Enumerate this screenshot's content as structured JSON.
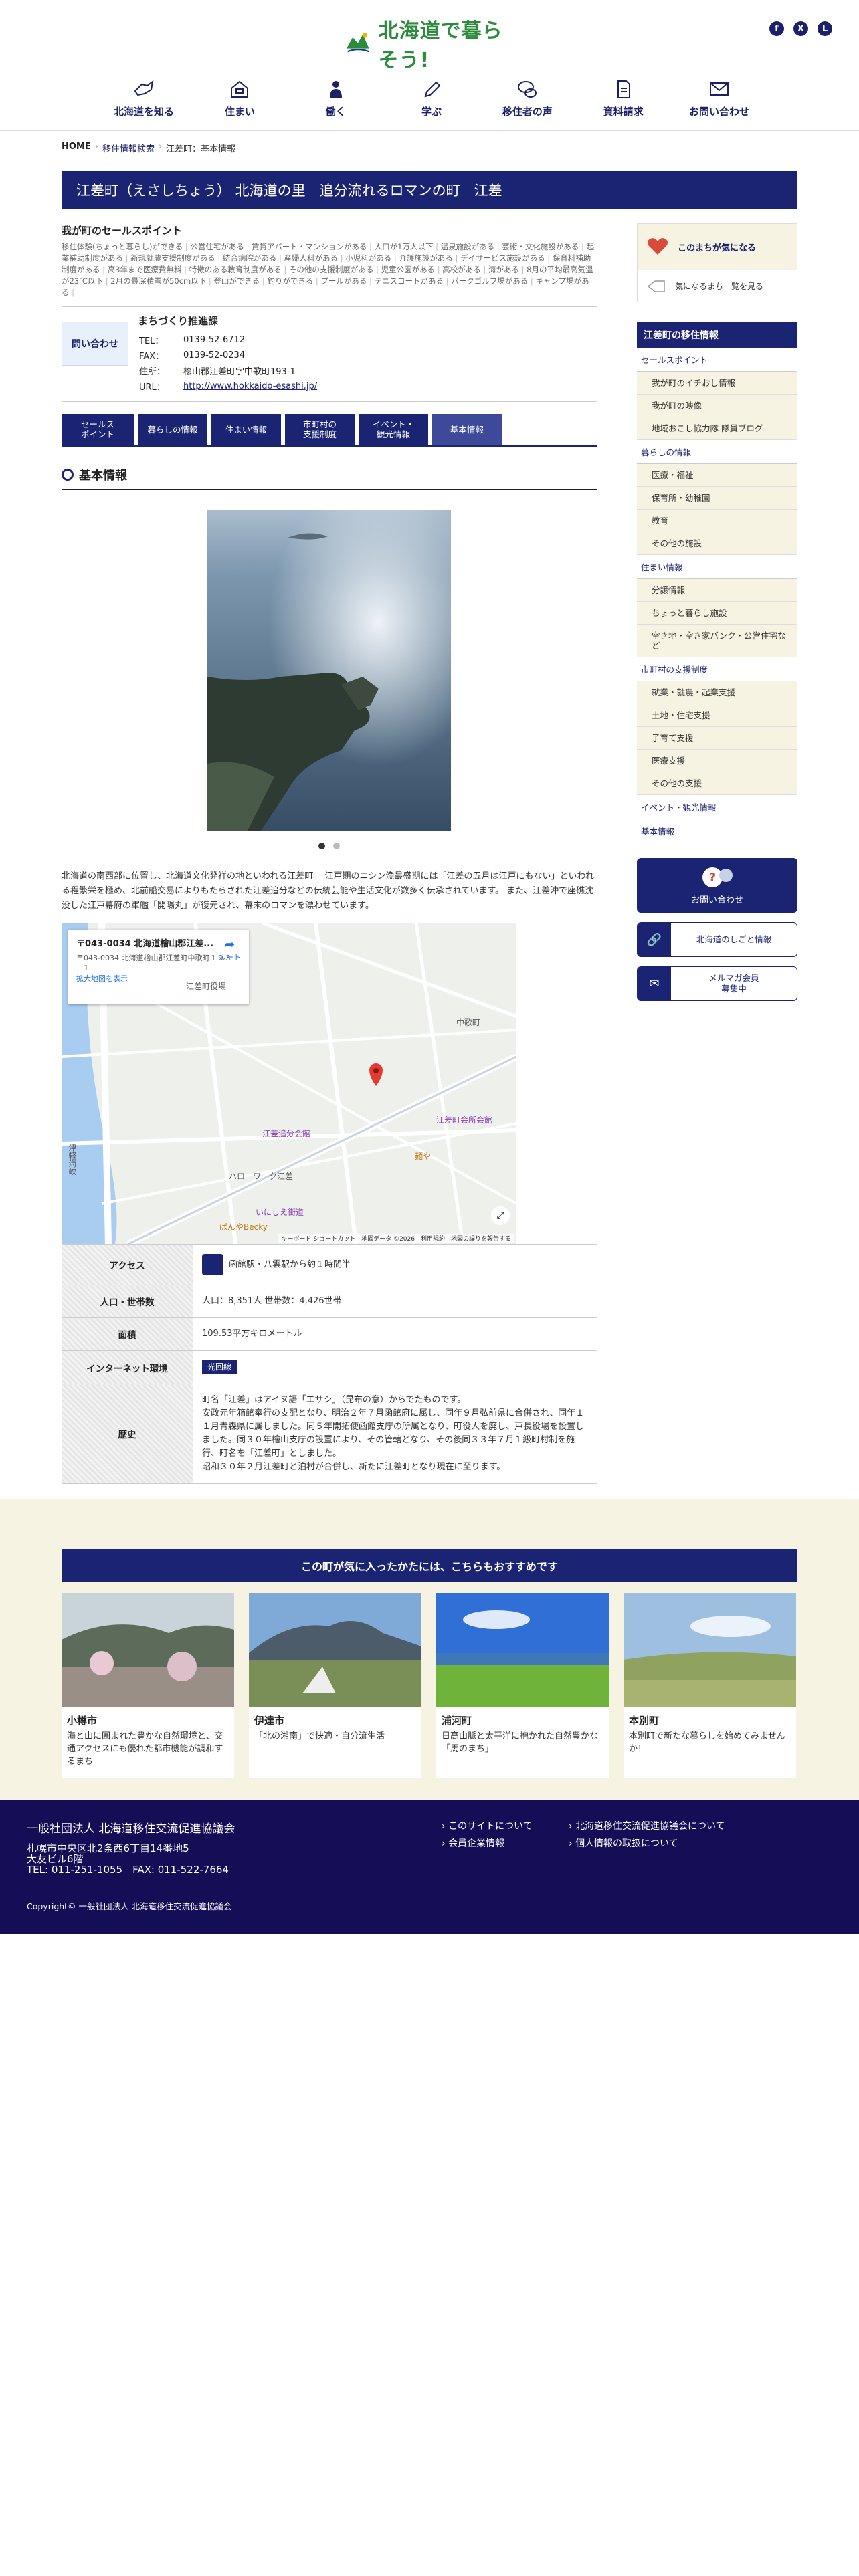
{
  "header": {
    "logo_text": "北海道で暮らそう!",
    "nav": [
      {
        "label": "北海道を知る",
        "icon": "hokkaido-icon"
      },
      {
        "label": "住まい",
        "icon": "house-icon"
      },
      {
        "label": "働く",
        "icon": "worker-icon"
      },
      {
        "label": "学ぶ",
        "icon": "pencil-icon"
      },
      {
        "label": "移住者の声",
        "icon": "speech-bubble-icon"
      },
      {
        "label": "資料請求",
        "icon": "document-icon"
      },
      {
        "label": "お問い合わせ",
        "icon": "mail-icon"
      }
    ],
    "social": [
      "facebook-icon",
      "x-icon",
      "line-icon"
    ]
  },
  "breadcrumb": [
    "HOME",
    "移住情報検索",
    "江差町：基本情報"
  ],
  "title": "江差町（えさしちょう） 北海道の里　追分流れるロマンの町　江差",
  "selling": {
    "heading": "我が町のセールスポイント",
    "tags": [
      "移住体験(ちょっと暮らし)ができる",
      "公営住宅がある",
      "賃貸アパート・マンションがある",
      "人口が1万人以下",
      "温泉施設がある",
      "芸術・文化施設がある",
      "起業補助制度がある",
      "新規就農支援制度がある",
      "結合病院がある",
      "産婦人科がある",
      "小児科がある",
      "介護施設がある",
      "デイサービス施設がある",
      "保育料補助制度がある",
      "高3年まで医療費無料",
      "特徴のある教育制度がある",
      "その他の支援制度がある",
      "児童公園がある",
      "高校がある",
      "海がある",
      "8月の平均最高気温が23℃以下",
      "2月の最深積雪が50cm以下",
      "登山ができる",
      "釣りができる",
      "プールがある",
      "テニスコートがある",
      "パークゴルフ場がある",
      "キャンプ場がある"
    ]
  },
  "contact": {
    "button_label": "問い合わせ",
    "org": "まちづくり推進課",
    "rows": [
      {
        "k": "TEL：",
        "v": "0139-52-6712"
      },
      {
        "k": "FAX：",
        "v": "0139-52-0234"
      },
      {
        "k": "住所：",
        "v": "桧山郡江差町字中歌町193-1"
      }
    ],
    "url_label": "URL：",
    "url": "http://www.hokkaido-esashi.jp/"
  },
  "tabs": [
    "セールス\nポイント",
    "暮らしの情報",
    "住まい情報",
    "市町村の\n支援制度",
    "イベント・\n観光情報",
    "基本情報"
  ],
  "section_title": "基本情報",
  "intro": "北海道の南西部に位置し、北海道文化発祥の地といわれる江差町。 江戸期のニシン漁最盛期には「江差の五月は江戸にもない」といわれる程繁栄を極め、北前船交易によりもたらされた江差追分などの伝統芸能や生活文化が数多く伝承されています。 また、江差沖で座礁沈没した江戸幕府の軍艦「開陽丸」が復元され、幕末のロマンを漂わせています。",
  "map": {
    "title": "〒043-0034 北海道檜山郡江差...",
    "address": "〒043-0034 北海道檜山郡江差町中歌町１９３−１",
    "route": "ルート",
    "enlarge": "拡大地図を表示",
    "labels": [
      "津軽海峡",
      "江差町役場",
      "江差追分会館",
      "江差町会所会館",
      "麺や",
      "ハローワーク江差",
      "いにしえ街道",
      "中歌町",
      "ぱんやBecky"
    ],
    "attribution": "キーボード ショートカット　地図データ ©2026　利用規約　地図の誤りを報告する"
  },
  "table": [
    {
      "k": "アクセス",
      "v": "函館駅・八雲駅から約１時間半"
    },
    {
      "k": "人口・世帯数",
      "v": "人口：8,351人 世帯数：4,426世帯"
    },
    {
      "k": "面積",
      "v": "109.53平方キロメートル"
    },
    {
      "k": "インターネット環境",
      "v": "光回線"
    },
    {
      "k": "歴史",
      "v": "町名「江差」はアイヌ語「エサシ」（昆布の意）からでたものです。\n安政元年箱館奉行の支配となり、明治２年７月函館府に属し、同年９月弘前県に合併され、同年１１月青森県に属しました。同５年開拓使函館支庁の所属となり、町役人を廃し、戸長役場を設置しました。同３０年檜山支庁の設置により、その管轄となり、その後同３３年７月１級町村制を施行、町名を「江差町」としました。\n昭和３０年２月江差町と泊村が合併し、新たに江差町となり現在に至ります。"
    }
  ],
  "sidebar": {
    "fav_label": "このまちが気になる",
    "fav_list_label": "気になるまち一覧を見る",
    "heading": "江差町の移住情報",
    "groups": [
      {
        "cat": "セールスポイント",
        "items": [
          "我が町のイチおし情報",
          "我が町の映像",
          "地域おこし協力隊 隊員ブログ"
        ]
      },
      {
        "cat": "暮らしの情報",
        "items": [
          "医療・福祉",
          "保育所・幼稚園",
          "教育",
          "その他の施設"
        ]
      },
      {
        "cat": "住まい情報",
        "items": [
          "分譲情報",
          "ちょっと暮らし施設",
          "空き地・空き家バンク・公営住宅など"
        ]
      },
      {
        "cat": "市町村の支援制度",
        "items": [
          "就業・就農・起業支援",
          "土地・住宅支援",
          "子育て支援",
          "医療支援",
          "その他の支援"
        ]
      }
    ],
    "extra_cats": [
      "イベント・観光情報",
      "基本情報"
    ],
    "inquiry": "お問い合わせ",
    "jobs": "北海道のしごと情報",
    "mailmag": "メルマガ会員\n募集中"
  },
  "recommend": {
    "heading": "この町が気に入ったかたには、こちらもおすすめです",
    "cards": [
      {
        "name": "小樽市",
        "desc": "海と山に囲まれた豊かな自然環境と、交通アクセスにも優れた都市機能が調和するまち"
      },
      {
        "name": "伊達市",
        "desc": "「北の湘南」で快適・自分流生活"
      },
      {
        "name": "浦河町",
        "desc": "日高山脈と太平洋に抱かれた自然豊かな「馬のまち」"
      },
      {
        "name": "本別町",
        "desc": "本別町で新たな暮らしを始めてみませんか！"
      }
    ]
  },
  "footer": {
    "org": "一般社団法人 北海道移住交流促進協議会",
    "address": "札幌市中央区北2条西6丁目14番地5\n大友ビル6階\nTEL: 011-251-1055　FAX: 011-522-7664",
    "links": [
      "このサイトについて",
      "北海道移住交流促進協議会について",
      "会員企業情報",
      "個人情報の取扱について"
    ],
    "copyright": "Copyright© 一般社団法人 北海道移住交流促進協議会"
  },
  "colors": {
    "navy": "#1b2473",
    "cream": "#f6f3e2",
    "footer": "#150d55",
    "logo_green": "#2a8c3c"
  }
}
